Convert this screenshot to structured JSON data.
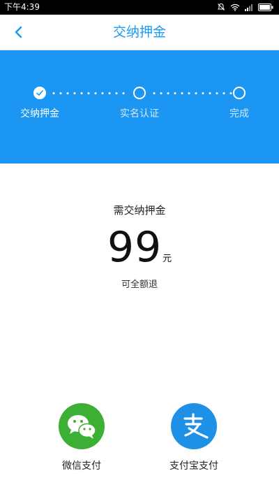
{
  "status_bar": {
    "time": "下午4:39"
  },
  "nav": {
    "title": "交纳押金"
  },
  "steps": [
    {
      "label": "交纳押金",
      "state": "done"
    },
    {
      "label": "实名认证",
      "state": "pending"
    },
    {
      "label": "完成",
      "state": "pending"
    }
  ],
  "deposit": {
    "caption": "需交纳押金",
    "amount": "99",
    "unit": "元",
    "note": "可全额退"
  },
  "payment_methods": [
    {
      "label": "微信支付",
      "icon": "wechat-pay-icon",
      "color": "#3cb034"
    },
    {
      "label": "支付宝支付",
      "icon": "alipay-icon",
      "color": "#1e90e6"
    }
  ],
  "colors": {
    "accent": "#1a9bf0",
    "banner": "#1b97f3"
  }
}
